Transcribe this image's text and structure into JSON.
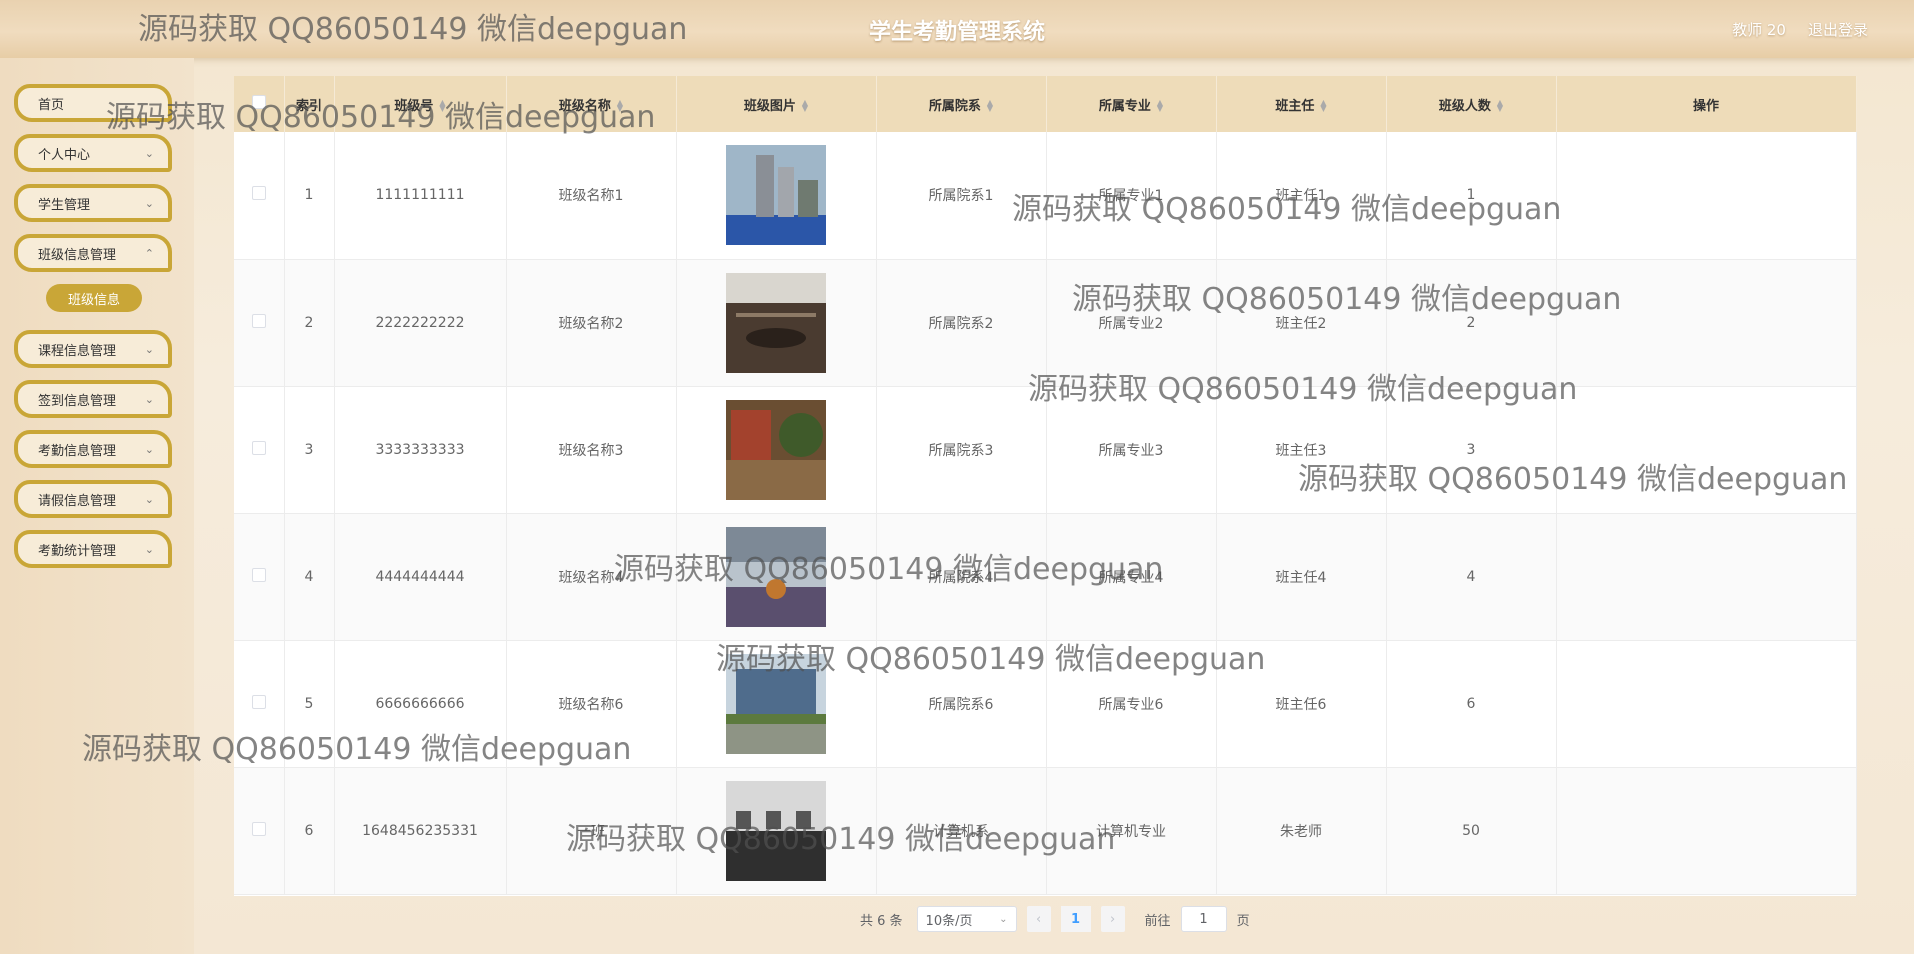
{
  "header": {
    "title": "学生考勤管理系统",
    "user": "教师 20",
    "logout": "退出登录"
  },
  "sidebar": {
    "items": [
      {
        "label": "首页"
      },
      {
        "label": "个人中心"
      },
      {
        "label": "学生管理"
      },
      {
        "label": "班级信息管理"
      },
      {
        "label": "课程信息管理"
      },
      {
        "label": "签到信息管理"
      },
      {
        "label": "考勤信息管理"
      },
      {
        "label": "请假信息管理"
      },
      {
        "label": "考勤统计管理"
      }
    ],
    "active_sub": "班级信息"
  },
  "table": {
    "columns": [
      "索引",
      "班级号",
      "班级名称",
      "班级图片",
      "所属院系",
      "所属专业",
      "班主任",
      "班级人数",
      "操作"
    ],
    "rows": [
      {
        "index": "1",
        "class_no": "1111111111",
        "name": "班级名称1",
        "dept": "所属院系1",
        "major": "所属专业1",
        "teacher": "班主任1",
        "count": "1"
      },
      {
        "index": "2",
        "class_no": "2222222222",
        "name": "班级名称2",
        "dept": "所属院系2",
        "major": "所属专业2",
        "teacher": "班主任2",
        "count": "2"
      },
      {
        "index": "3",
        "class_no": "3333333333",
        "name": "班级名称3",
        "dept": "所属院系3",
        "major": "所属专业3",
        "teacher": "班主任3",
        "count": "3"
      },
      {
        "index": "4",
        "class_no": "4444444444",
        "name": "班级名称4",
        "dept": "所属院系4",
        "major": "所属专业4",
        "teacher": "班主任4",
        "count": "4"
      },
      {
        "index": "5",
        "class_no": "6666666666",
        "name": "班级名称6",
        "dept": "所属院系6",
        "major": "所属专业6",
        "teacher": "班主任6",
        "count": "6"
      },
      {
        "index": "6",
        "class_no": "1648456235331",
        "name": "一班",
        "dept": "计算机系",
        "major": "计算机专业",
        "teacher": "朱老师",
        "count": "50"
      }
    ]
  },
  "pagination": {
    "total": "共 6 条",
    "page_size": "10条/页",
    "current_page": "1",
    "goto_label": "前往",
    "goto_value": "1",
    "page_suffix": "页"
  },
  "watermark": "源码获取 QQ86050149 微信deepguan",
  "colors": {
    "accent": "#c9a637",
    "header_row": "#eedcb9",
    "background": "#f3e6cf"
  }
}
